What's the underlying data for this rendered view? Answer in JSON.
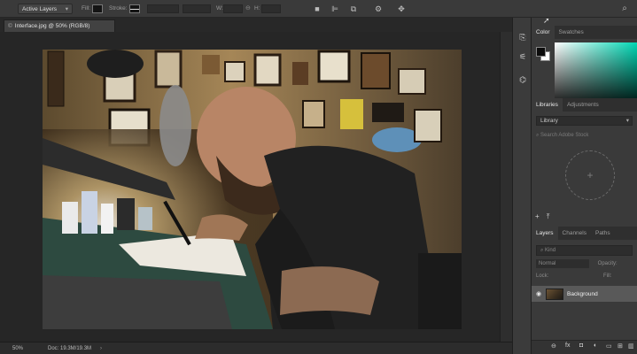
{
  "options_bar": {
    "mode_select": "Active Layers",
    "fill_label": "Fill:",
    "stroke_label": "Stroke:",
    "width_label": "W:",
    "height_label": "H:"
  },
  "document_tab": {
    "close_glyph": "©",
    "title": "Interface.jpg @ 50% (RGB/8)"
  },
  "status_bar": {
    "zoom": "50%",
    "doc_info": "Doc: 19.3M/19.3M"
  },
  "panels": {
    "color_tabs": [
      "Color",
      "Swatches"
    ],
    "library_tabs": [
      "Libraries",
      "Adjustments"
    ],
    "library_select": "Library",
    "library_search_placeholder": "Search Adobe Stock",
    "layers_tabs": [
      "Layers",
      "Channels",
      "Paths"
    ],
    "kind_filter": "Kind",
    "blend_mode": "Normal",
    "opacity_label": "Opacity:",
    "lock_label": "Lock:",
    "fill_label": "Fill:",
    "layer_name": "Background"
  },
  "colors": {
    "foreground": "#0c0c0c",
    "background": "#ffffff",
    "picker_hue": "#00d7b4"
  },
  "icons": {
    "align_icons": [
      "align-left-icon",
      "align-center-icon",
      "align-right-icon",
      "path-ops-icon"
    ],
    "strip_icons": [
      "history-icon",
      "properties-icon",
      "paths-icon"
    ]
  }
}
